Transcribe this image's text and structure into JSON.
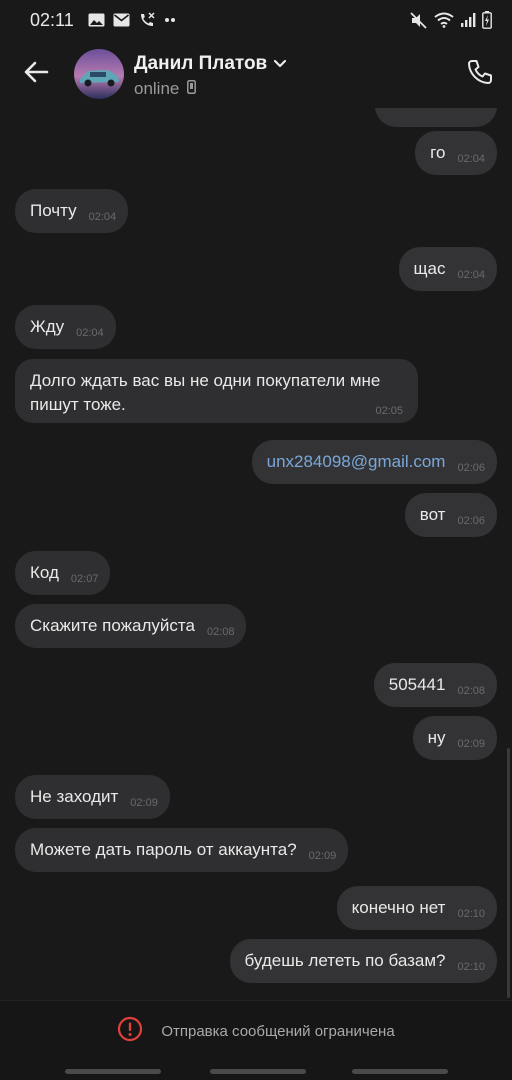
{
  "status_bar": {
    "time": "02:11"
  },
  "header": {
    "contact_name": "Данил Платов",
    "contact_status": "online"
  },
  "messages": [
    {
      "dir": "out",
      "text": "го",
      "time": "02:04"
    },
    {
      "dir": "in",
      "text": "Почту",
      "time": "02:04"
    },
    {
      "dir": "out",
      "text": "щас",
      "time": "02:04"
    },
    {
      "dir": "in",
      "text": "Жду",
      "time": "02:04"
    },
    {
      "dir": "in",
      "text": "Долго ждать вас вы не одни покупатели мне пишут тоже.",
      "time": "02:05"
    },
    {
      "dir": "out",
      "text": "unx284098@gmail.com",
      "time": "02:06"
    },
    {
      "dir": "out",
      "text": "вот",
      "time": "02:06"
    },
    {
      "dir": "in",
      "text": "Код",
      "time": "02:07"
    },
    {
      "dir": "in",
      "text": "Скажите пожалуйста",
      "time": "02:08"
    },
    {
      "dir": "out",
      "text": "505441",
      "time": "02:08"
    },
    {
      "dir": "out",
      "text": "ну",
      "time": "02:09"
    },
    {
      "dir": "in",
      "text": "Не заходит",
      "time": "02:09"
    },
    {
      "dir": "in",
      "text": "Можете дать пароль от аккаунта?",
      "time": "02:09"
    },
    {
      "dir": "out",
      "text": "конечно нет",
      "time": "02:10"
    },
    {
      "dir": "out",
      "text": "будешь лететь по базам?",
      "time": "02:10"
    }
  ],
  "footer": {
    "restriction_text": "Отправка сообщений ограничена"
  },
  "colors": {
    "background": "#19191a",
    "bubble": "#2f2f31",
    "link": "#7aa7d9",
    "warning": "#e0413a"
  },
  "icons": [
    "back-arrow-icon",
    "phone-icon",
    "chevron-down-icon",
    "mobile-device-icon",
    "warning-icon"
  ]
}
